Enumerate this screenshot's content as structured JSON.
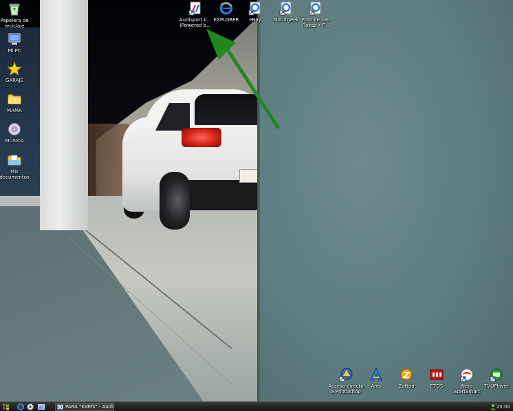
{
  "desktop": {
    "left_icons": [
      {
        "label": "Papelera de reciclaje",
        "icon": "recycle-bin-icon"
      },
      {
        "label": "Mi PC",
        "icon": "computer-icon"
      },
      {
        "label": "GARAJE",
        "icon": "star-icon"
      },
      {
        "label": "MAMA",
        "icon": "folder-icon"
      },
      {
        "label": "MÚSICA",
        "icon": "cd-icon"
      },
      {
        "label": "Mis documentos",
        "icon": "documents-folder-icon"
      }
    ],
    "top_icons": [
      {
        "label": "Audisport.il... (Powered b...",
        "icon": "audisport-shortcut-icon"
      },
      {
        "label": "EXPLORER",
        "icon": "internet-explorer-icon"
      },
      {
        "label": "eBay",
        "icon": "ebay-ie-icon"
      },
      {
        "label": "Motorgeek",
        "icon": "motorgeek-ie-icon"
      },
      {
        "label": "Foro de Las Rozas • P...",
        "icon": "foro-ie-icon"
      }
    ],
    "bottom_icons": [
      {
        "label": "Acceso directo a Photoshop",
        "icon": "photoshop-shortcut-icon"
      },
      {
        "label": "Ares",
        "icon": "ares-icon"
      },
      {
        "label": "Zattoo",
        "icon": "zattoo-icon"
      },
      {
        "label": "ETOS",
        "icon": "etos-icon"
      },
      {
        "label": "Nero StartSmart",
        "icon": "nero-icon"
      },
      {
        "label": "TVUPlayer",
        "icon": "tvuplayer-icon"
      }
    ]
  },
  "taskbar": {
    "start_icon": "windows-start-icon",
    "quicklaunch": [
      "ie-quicklaunch-icon",
      "media-player-quicklaunch-icon",
      "show-desktop-quicklaunch-icon"
    ],
    "task_label": "PARA \"KaRTs\" - Audis...",
    "clock": "23:00"
  },
  "colors": {
    "arrow": "#1e8a1e",
    "taskbar": "#262626",
    "pillar": "#5e7d81"
  }
}
